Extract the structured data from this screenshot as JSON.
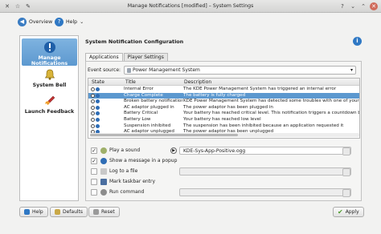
{
  "window": {
    "title": "Manage Notifications [modified] – System Settings"
  },
  "toolbar": {
    "overview_label": "Overview",
    "help_label": "Help"
  },
  "sidebar": {
    "items": [
      {
        "label": "Manage Notifications",
        "active": true
      },
      {
        "label": "System Bell",
        "active": false
      },
      {
        "label": "Launch Feedback",
        "active": false
      }
    ]
  },
  "content": {
    "title": "System Notification Configuration",
    "tabs": [
      {
        "label": "Applications",
        "active": true
      },
      {
        "label": "Player Settings",
        "active": false
      }
    ],
    "event_source_label": "Event source:",
    "event_source_value": "Power Management System",
    "table": {
      "headers": [
        "State",
        "Title",
        "Description"
      ],
      "rows": [
        {
          "title": "Internal Error",
          "desc": "The KDE Power Management System has triggered an internal error",
          "selected": false
        },
        {
          "title": "Charge Complete",
          "desc": "The battery is fully charged",
          "selected": true
        },
        {
          "title": "Broken battery notification",
          "desc": "KDE Power Management System has detected some troubles with one of your battery",
          "selected": false
        },
        {
          "title": "AC adaptor plugged in",
          "desc": "The power adaptor has been plugged in",
          "selected": false
        },
        {
          "title": "Battery Critical",
          "desc": "Your battery has reached critical level. This notification triggers a countdown before",
          "selected": false
        },
        {
          "title": "Battery Low",
          "desc": "Your battery has reached low level",
          "selected": false
        },
        {
          "title": "Suspension inhibited",
          "desc": "The suspension has been inhibited because an application requested it",
          "selected": false
        },
        {
          "title": "AC adaptor unplugged",
          "desc": "The power adaptor has been unplugged",
          "selected": false
        }
      ]
    },
    "actions": {
      "play_sound": {
        "label": "Play a sound",
        "checked": true,
        "value": "KDE-Sys-App-Positive.ogg"
      },
      "show_popup": {
        "label": "Show a message in a popup",
        "checked": true
      },
      "log_file": {
        "label": "Log to a file",
        "checked": false
      },
      "taskbar": {
        "label": "Mark taskbar entry",
        "checked": false
      },
      "run_command": {
        "label": "Run command",
        "checked": false
      }
    }
  },
  "bottom": {
    "help_label": "Help",
    "defaults_label": "Defaults",
    "reset_label": "Reset",
    "apply_label": "Apply"
  },
  "colors": {
    "accent": "#5c98cf",
    "info_blue": "#2f6db5",
    "apply_green": "#4c9a2a"
  }
}
